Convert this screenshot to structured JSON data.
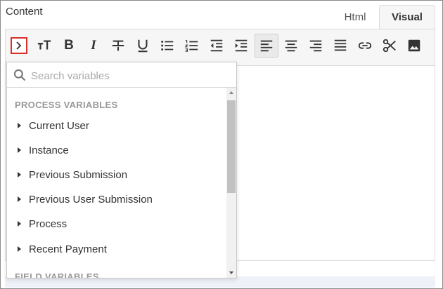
{
  "header": {
    "content_label": "Content",
    "tabs": [
      {
        "label": "Html",
        "active": false
      },
      {
        "label": "Visual",
        "active": true
      }
    ]
  },
  "toolbar": {
    "buttons": [
      {
        "icon": "insert-variable-icon",
        "highlighted": true
      },
      {
        "icon": "font-size-icon"
      },
      {
        "icon": "bold-icon",
        "glyph": "B"
      },
      {
        "icon": "italic-icon",
        "glyph": "I"
      },
      {
        "icon": "strikethrough-icon"
      },
      {
        "icon": "underline-icon"
      },
      {
        "icon": "bullet-list-icon"
      },
      {
        "icon": "numbered-list-icon"
      },
      {
        "icon": "outdent-icon"
      },
      {
        "icon": "indent-icon"
      },
      {
        "icon": "align-left-icon",
        "active": true
      },
      {
        "icon": "align-center-icon"
      },
      {
        "icon": "align-right-icon"
      },
      {
        "icon": "justify-icon"
      },
      {
        "icon": "link-icon"
      },
      {
        "icon": "cut-icon"
      },
      {
        "icon": "image-icon"
      }
    ]
  },
  "variables": {
    "search_placeholder": "Search variables",
    "search_value": "",
    "process_section": "PROCESS VARIABLES",
    "items": [
      {
        "label": "Current User"
      },
      {
        "label": "Instance"
      },
      {
        "label": "Previous Submission"
      },
      {
        "label": "Previous User Submission"
      },
      {
        "label": "Process"
      },
      {
        "label": "Recent Payment"
      }
    ],
    "field_section": "FIELD VARIABLES"
  },
  "colors": {
    "highlight_border": "#d9302b",
    "toolbar_bg": "#f6f6f6",
    "section_text": "#999999"
  }
}
